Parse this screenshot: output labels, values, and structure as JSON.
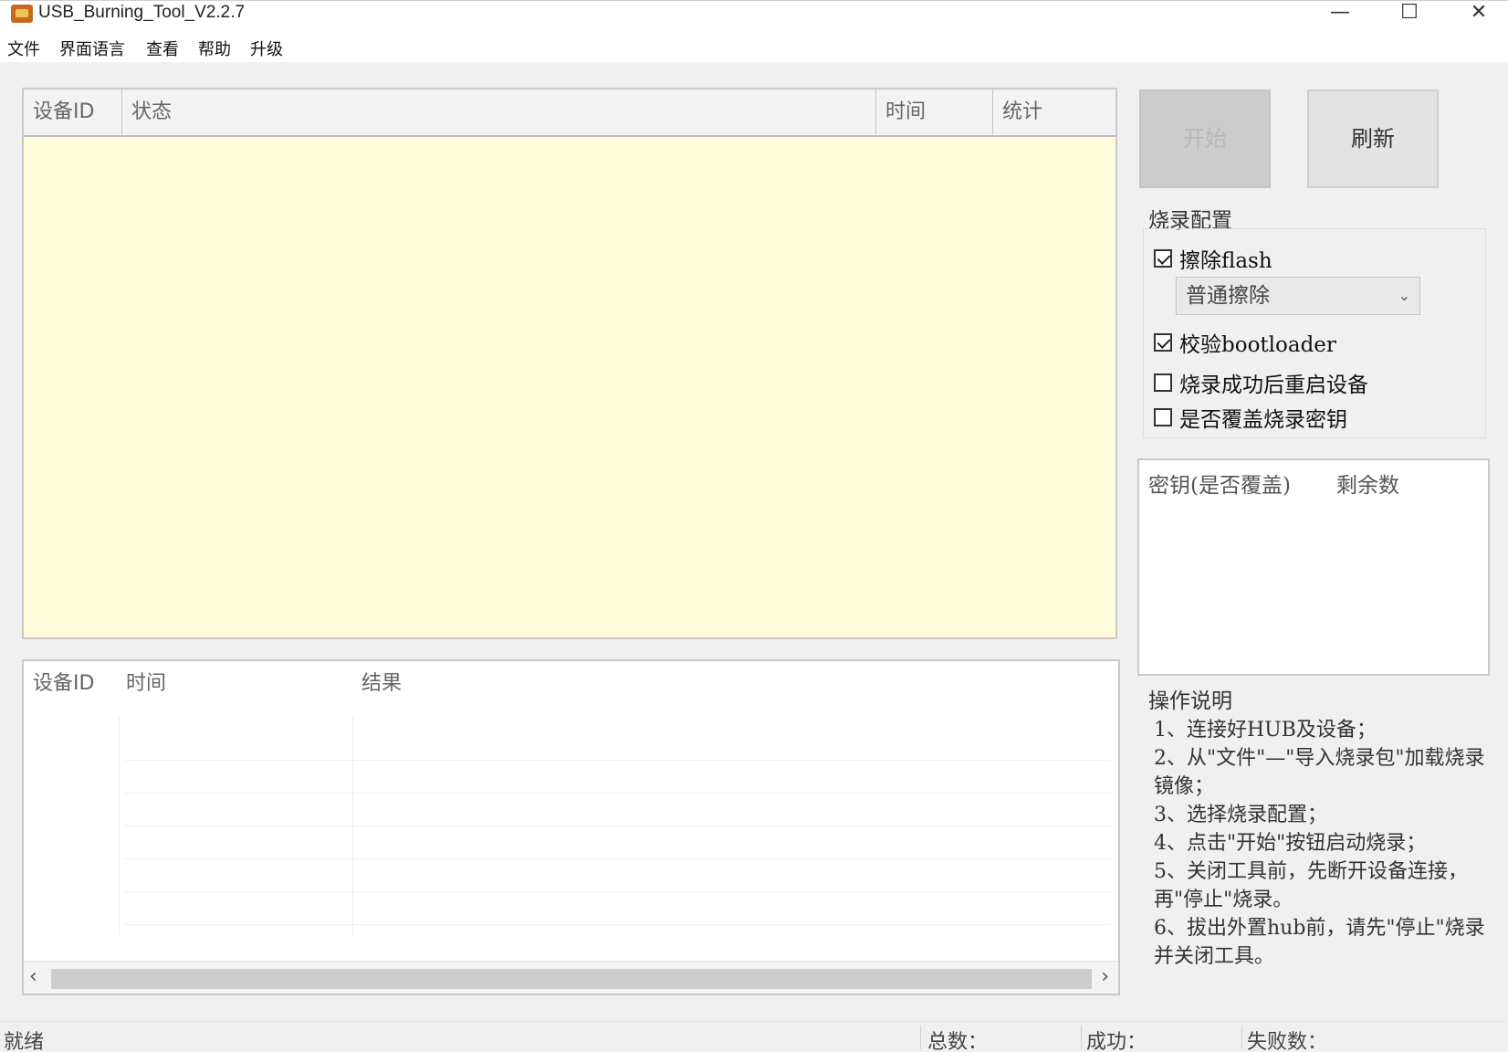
{
  "window": {
    "title": "USB_Burning_Tool_V2.2.7",
    "minimize": "—",
    "maximize": "☐",
    "close": "✕"
  },
  "menu": [
    "文件",
    "界面语言",
    "查看",
    "帮助",
    "升级"
  ],
  "device_table": {
    "columns": [
      "设备ID",
      "状态",
      "时间",
      "统计"
    ]
  },
  "result_table": {
    "columns": [
      "设备ID",
      "时间",
      "结果"
    ],
    "scroll_left": "‹",
    "scroll_right": "›"
  },
  "buttons": {
    "start": "开始",
    "refresh": "刷新"
  },
  "config": {
    "title": "烧录配置",
    "erase_flash": "擦除flash",
    "erase_flash_checked": true,
    "erase_mode": "普通擦除",
    "verify_bootloader": "校验bootloader",
    "verify_bootloader_checked": true,
    "reboot_after": "烧录成功后重启设备",
    "reboot_after_checked": false,
    "overwrite_key": "是否覆盖烧录密钥",
    "overwrite_key_checked": false
  },
  "key_table": {
    "columns": [
      "密钥(是否覆盖)",
      "剩余数"
    ]
  },
  "instructions": {
    "title": "操作说明",
    "lines": [
      "1、连接好HUB及设备；",
      "2、从\"文件\"—\"导入烧录包\"加载烧录镜像；",
      "3、选择烧录配置；",
      "4、点击\"开始\"按钮启动烧录；",
      "5、关闭工具前，先断开设备连接，再\"停止\"烧录。",
      "6、拔出外置hub前，请先\"停止\"烧录并关闭工具。"
    ]
  },
  "status": {
    "ready": "就绪",
    "total": "总数：",
    "success": "成功：",
    "fail": "失败数："
  }
}
